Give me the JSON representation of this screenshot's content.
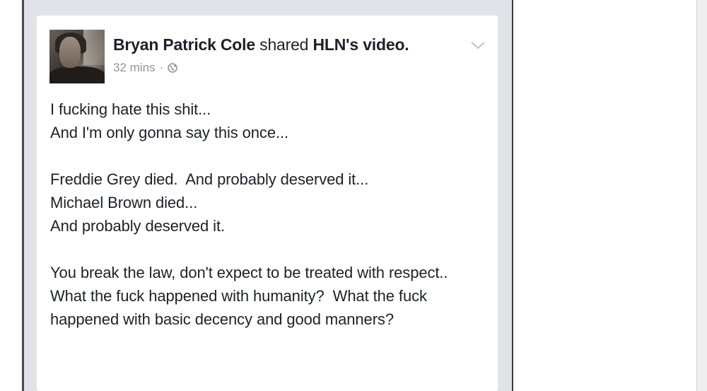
{
  "post": {
    "author": "Bryan Patrick Cole",
    "action": "shared",
    "shared_source": "HLN's",
    "shared_type": "video.",
    "timestamp": "32 mins",
    "separator": "·",
    "privacy_icon": "globe-icon",
    "menu_icon": "chevron-down-icon",
    "body": "I fucking hate this shit...\nAnd I'm only gonna say this once...\n\nFreddie Grey died.  And probably deserved it...\nMichael Brown died...\nAnd probably deserved it.\n\nYou break the law, don't expect to be treated with respect..\nWhat the fuck happened with humanity?  What the fuck happened with basic decency and good manners?"
  },
  "colors": {
    "text": "#1d2129",
    "meta": "#90949c",
    "frame": "#e1e3e9"
  }
}
